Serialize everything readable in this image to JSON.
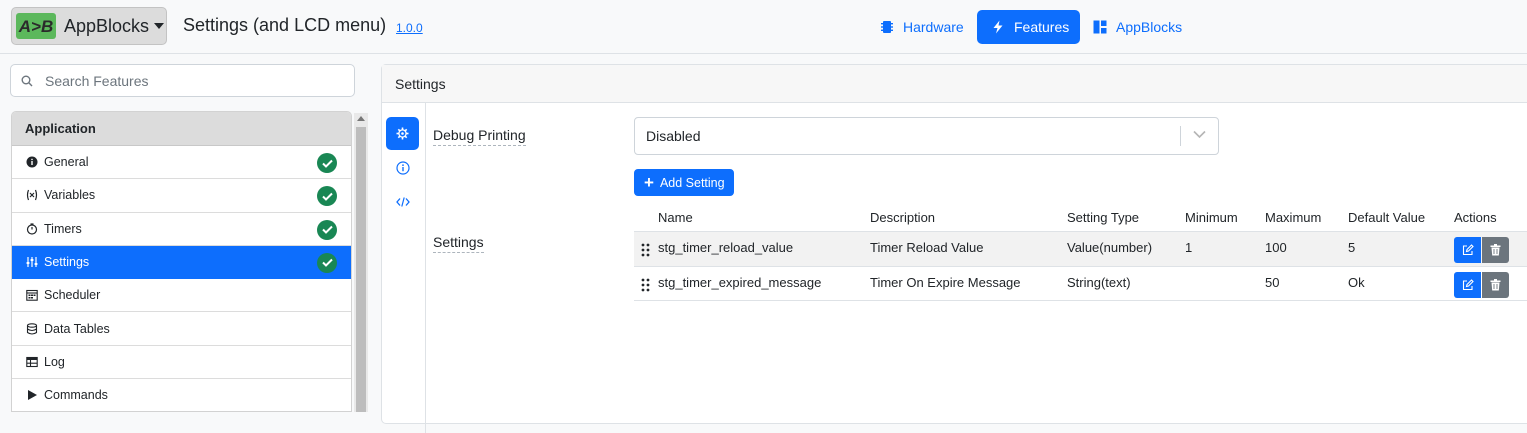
{
  "header": {
    "brand_label": "AppBlocks",
    "logo_text": "A>B",
    "title": "Settings (and LCD menu)",
    "version": "1.0.0",
    "tabs": [
      {
        "label": "Hardware",
        "icon": "chip-icon",
        "active": false
      },
      {
        "label": "Features",
        "icon": "bolt-icon",
        "active": true
      },
      {
        "label": "AppBlocks",
        "icon": "blocks-icon",
        "active": false
      }
    ]
  },
  "sidebar": {
    "search_placeholder": "Search Features",
    "section_title": "Application",
    "items": [
      {
        "label": "General",
        "icon": "info-circle-icon",
        "checked": true,
        "active": false
      },
      {
        "label": "Variables",
        "icon": "variable-icon",
        "checked": true,
        "active": false
      },
      {
        "label": "Timers",
        "icon": "stopwatch-icon",
        "checked": true,
        "active": false
      },
      {
        "label": "Settings",
        "icon": "sliders-icon",
        "checked": true,
        "active": true
      },
      {
        "label": "Scheduler",
        "icon": "calendar-icon",
        "checked": false,
        "active": false
      },
      {
        "label": "Data Tables",
        "icon": "database-icon",
        "checked": false,
        "active": false
      },
      {
        "label": "Log",
        "icon": "table-icon",
        "checked": false,
        "active": false
      },
      {
        "label": "Commands",
        "icon": "play-icon",
        "checked": false,
        "active": false
      }
    ]
  },
  "panel": {
    "title": "Settings",
    "debug_label": "Debug Printing",
    "debug_value": "Disabled",
    "add_button_label": "Add Setting",
    "settings_label": "Settings",
    "columns": [
      "Name",
      "Description",
      "Setting Type",
      "Minimum",
      "Maximum",
      "Default Value",
      "Actions"
    ],
    "rows": [
      {
        "name": "stg_timer_reload_value",
        "description": "Timer Reload Value",
        "type": "Value(number)",
        "min": "1",
        "max": "100",
        "default": "5"
      },
      {
        "name": "stg_timer_expired_message",
        "description": "Timer On Expire Message",
        "type": "String(text)",
        "min": "",
        "max": "50",
        "default": "Ok"
      }
    ]
  },
  "colors": {
    "primary": "#0d6efd",
    "success": "#198754",
    "secondary": "#6c757d",
    "logo_green": "#5cb85c"
  }
}
